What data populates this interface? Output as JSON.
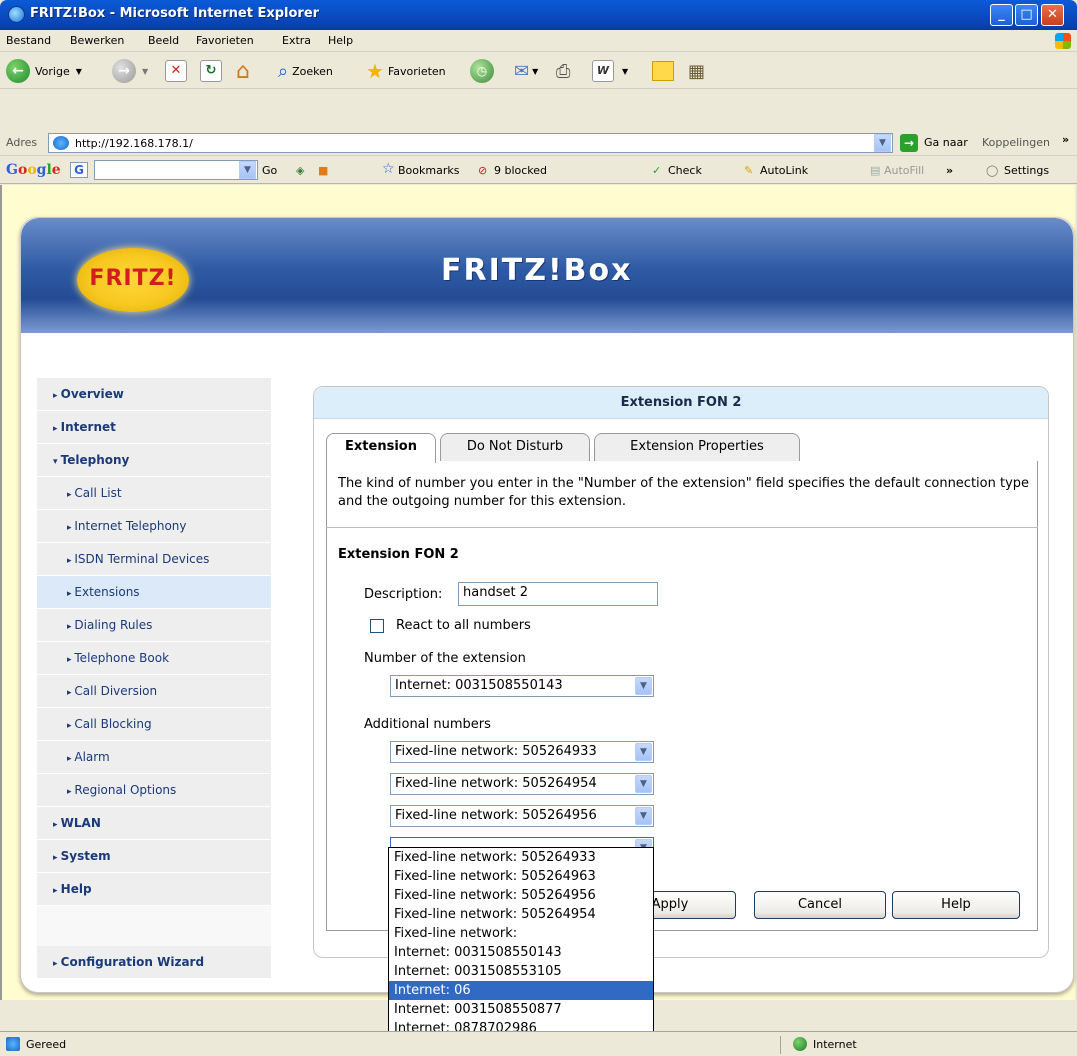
{
  "window": {
    "title": "FRITZ!Box - Microsoft Internet Explorer"
  },
  "menu": [
    "Bestand",
    "Bewerken",
    "Beeld",
    "Favorieten",
    "Extra",
    "Help"
  ],
  "toolbar": {
    "back": "Vorige",
    "search": "Zoeken",
    "favorites": "Favorieten"
  },
  "address": {
    "label": "Adres",
    "url": "http://192.168.178.1/",
    "go": "Ga naar",
    "links": "Koppelingen"
  },
  "googlebar": {
    "logo": "Google",
    "go": "Go",
    "bookmarks": "Bookmarks",
    "blocked": "9 blocked",
    "check": "Check",
    "autolink": "AutoLink",
    "autofill": "AutoFill",
    "settings": "Settings"
  },
  "header": {
    "logo_text": "FRITZ!",
    "brand": "FRITZ!Box"
  },
  "sidebar": {
    "items": [
      {
        "label": "Overview",
        "level": "top"
      },
      {
        "label": "Internet",
        "level": "top"
      },
      {
        "label": "Telephony",
        "level": "top",
        "expanded": true
      },
      {
        "label": "Call List",
        "level": "sub"
      },
      {
        "label": "Internet Telephony",
        "level": "sub"
      },
      {
        "label": "ISDN Terminal Devices",
        "level": "sub"
      },
      {
        "label": "Extensions",
        "level": "sub",
        "active": true
      },
      {
        "label": "Dialing Rules",
        "level": "sub"
      },
      {
        "label": "Telephone Book",
        "level": "sub"
      },
      {
        "label": "Call Diversion",
        "level": "sub"
      },
      {
        "label": "Call Blocking",
        "level": "sub"
      },
      {
        "label": "Alarm",
        "level": "sub"
      },
      {
        "label": "Regional Options",
        "level": "sub"
      },
      {
        "label": "WLAN",
        "level": "top"
      },
      {
        "label": "System",
        "level": "top"
      },
      {
        "label": "Help",
        "level": "top"
      }
    ],
    "wizard": "Configuration Wizard"
  },
  "panel": {
    "title": "Extension FON 2",
    "tabs": [
      "Extension",
      "Do Not Disturb",
      "Extension Properties"
    ],
    "intro": "The kind of number you enter in the \"Number of the extension\" field specifies the default connection type and the outgoing number for this extension.",
    "section_title": "Extension FON 2",
    "description_label": "Description:",
    "description_value": "handset 2",
    "react_label": "React to all numbers",
    "number_label": "Number of the extension",
    "number_value": "Internet: 0031508550143",
    "additional_label": "Additional numbers",
    "additional": [
      "Fixed-line network: 505264933",
      "Fixed-line network: 505264954",
      "Fixed-line network: 505264956",
      ""
    ],
    "buttons": {
      "apply": "Apply",
      "cancel": "Cancel",
      "help": "Help"
    }
  },
  "dropdown": {
    "options": [
      "Fixed-line network: 505264933",
      "Fixed-line network: 505264963",
      "Fixed-line network: 505264956",
      "Fixed-line network: 505264954",
      "Fixed-line network:",
      "Internet: 0031508550143",
      "Internet: 0031508553105",
      "Internet: 06",
      "Internet: 0031508550877",
      "Internet: 0878702986"
    ],
    "highlighted": "Internet: 06"
  },
  "status": {
    "text": "Gereed",
    "zone": "Internet"
  }
}
